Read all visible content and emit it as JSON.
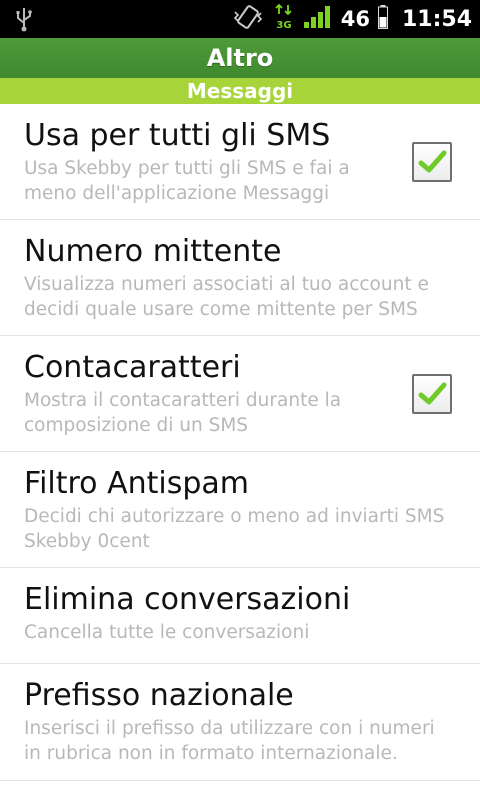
{
  "status_bar": {
    "battery_percent": "46",
    "time": "11:54",
    "network": "3G",
    "icons": [
      "usb-icon",
      "vibrate-icon",
      "data-3g-icon",
      "signal-icon",
      "battery-icon"
    ]
  },
  "header": {
    "title": "Altro",
    "section": "Messaggi"
  },
  "colors": {
    "title_bar": "#4f9a3b",
    "section_bar": "#a7d439",
    "check": "#6fcb2a"
  },
  "preferences": [
    {
      "title": "Usa per tutti gli SMS",
      "summary": "Usa Skebby per tutti gli SMS e fai a meno dell'applicazione Messaggi",
      "checked": true
    },
    {
      "title": "Numero mittente",
      "summary": "Visualizza numeri associati al tuo account e decidi quale usare come mittente per SMS",
      "checked": null
    },
    {
      "title": "Contacaratteri",
      "summary": "Mostra il contacaratteri durante la composizione di un SMS",
      "checked": true
    },
    {
      "title": "Filtro Antispam",
      "summary": "Decidi chi autorizzare o meno ad inviarti SMS Skebby 0cent",
      "checked": null
    },
    {
      "title": "Elimina conversazioni",
      "summary": "Cancella tutte le conversazioni",
      "checked": null
    },
    {
      "title": "Prefisso nazionale",
      "summary": "Inserisci il prefisso da utilizzare con i numeri in rubrica non in formato internazionale.",
      "checked": null
    }
  ]
}
